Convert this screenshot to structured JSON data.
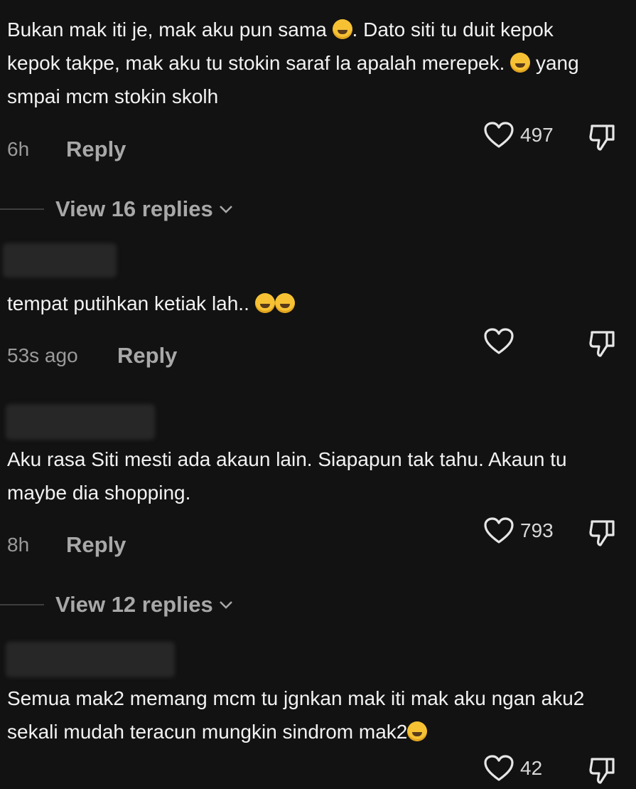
{
  "comments": [
    {
      "text": "Bukan mak iti je, mak aku pun sama ",
      "text_tail": ". Dato siti tu duit kepok kepok takpe, mak aku tu stokin saraf la apalah merepek. ",
      "text_tail2": " yang smpai mcm stokin skolh",
      "time": "6h",
      "reply": "Reply",
      "likes": "497",
      "view_replies": "View 16 replies"
    },
    {
      "text": "tempat putihkan ketiak lah.. ",
      "time": "53s ago",
      "reply": "Reply",
      "likes": ""
    },
    {
      "text": "Aku rasa Siti mesti ada akaun lain. Siapapun tak tahu. Akaun tu maybe dia shopping.",
      "time": "8h",
      "reply": "Reply",
      "likes": "793",
      "view_replies": "View 12 replies"
    },
    {
      "text": "Semua mak2 memang mcm tu jgnkan mak iti mak aku ngan aku2 sekali mudah teracun mungkin sindrom mak2",
      "likes": "42"
    }
  ],
  "icons": {
    "like": "heart-outline-icon",
    "dislike": "thumbs-down-icon",
    "expand": "chevron-down-icon"
  },
  "colors": {
    "background": "#121212",
    "text": "#f2f2f2",
    "muted": "#a8a8a8",
    "emoji": "#f6c234"
  }
}
